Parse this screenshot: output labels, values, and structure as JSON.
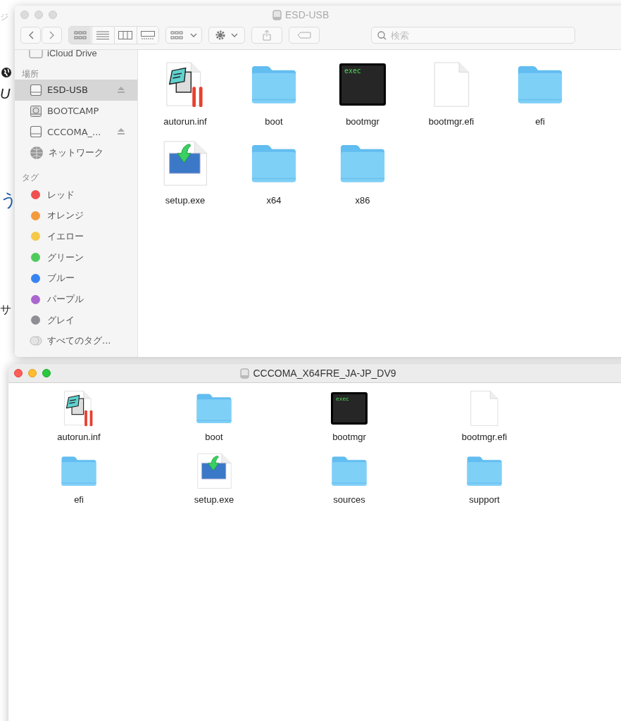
{
  "background_page": {
    "fragments": [
      {
        "kind": "top",
        "text": "ジ"
      },
      {
        "kind": "italic",
        "text": "U"
      },
      {
        "kind": "blue",
        "text": "う"
      },
      {
        "kind": "plain",
        "text": "サ"
      }
    ]
  },
  "finder_window": {
    "title": "ESD-USB",
    "active": false,
    "view_buttons": [
      {
        "kind": "icons",
        "selected": true
      },
      {
        "kind": "list",
        "selected": false
      },
      {
        "kind": "columns",
        "selected": false
      },
      {
        "kind": "gallery",
        "selected": false
      }
    ],
    "search": {
      "placeholder": "検索"
    },
    "sidebar": {
      "top_item": "iCloud Drive",
      "locations_header": "場所",
      "locations": [
        {
          "label": "ESD-USB",
          "kind": "drive",
          "eject": true,
          "selected": true
        },
        {
          "label": "BOOTCAMP",
          "kind": "disk",
          "eject": false,
          "selected": false
        },
        {
          "label": "CCCOMA_...",
          "kind": "drive",
          "eject": true,
          "selected": false
        },
        {
          "label": "ネットワーク",
          "kind": "network",
          "eject": false,
          "selected": false
        }
      ],
      "tags_header": "タグ",
      "tags": [
        {
          "label": "レッド",
          "color": "#ef5050"
        },
        {
          "label": "オレンジ",
          "color": "#f39a3c"
        },
        {
          "label": "イエロー",
          "color": "#f6c94a"
        },
        {
          "label": "グリーン",
          "color": "#4fcb5c"
        },
        {
          "label": "ブルー",
          "color": "#3684f2"
        },
        {
          "label": "パープル",
          "color": "#aa66cf"
        },
        {
          "label": "グレイ",
          "color": "#8e8e93"
        }
      ],
      "all_tags": "すべてのタグ..."
    },
    "items": [
      {
        "name": "autorun.inf",
        "kind": "notepad"
      },
      {
        "name": "boot",
        "kind": "folder"
      },
      {
        "name": "bootmgr",
        "kind": "exec",
        "icon_text": "exec"
      },
      {
        "name": "bootmgr.efi",
        "kind": "blank"
      },
      {
        "name": "efi",
        "kind": "folder"
      },
      {
        "name": "setup.exe",
        "kind": "setup"
      },
      {
        "name": "x64",
        "kind": "folder"
      },
      {
        "name": "x86",
        "kind": "folder"
      }
    ]
  },
  "disk_window": {
    "title": "CCCOMA_X64FRE_JA-JP_DV9",
    "active": true,
    "items": [
      {
        "name": "autorun.inf",
        "kind": "notepad"
      },
      {
        "name": "boot",
        "kind": "folder"
      },
      {
        "name": "bootmgr",
        "kind": "exec",
        "icon_text": "exec"
      },
      {
        "name": "bootmgr.efi",
        "kind": "blank"
      },
      {
        "name": "efi",
        "kind": "folder"
      },
      {
        "name": "setup.exe",
        "kind": "setup"
      },
      {
        "name": "sources",
        "kind": "folder"
      },
      {
        "name": "support",
        "kind": "folder"
      }
    ]
  }
}
